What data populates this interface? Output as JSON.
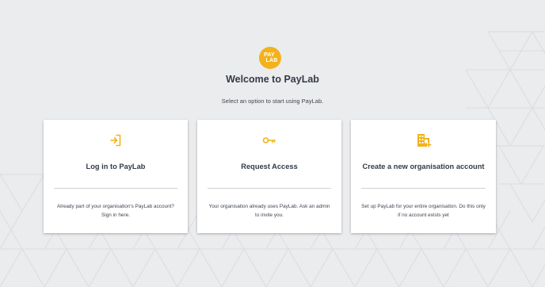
{
  "logo": {
    "line1": "PAY",
    "line2": "LAB"
  },
  "title": "Welcome to PayLab",
  "subtitle": "Select an option to start using PayLab.",
  "accent_color": "#f3b21b",
  "cards": [
    {
      "icon": "login-arrow-icon",
      "title": "Log in to PayLab",
      "description": "Already part of your organisation's PayLab account? Sign in here."
    },
    {
      "icon": "key-icon",
      "title": "Request Access",
      "description": "Your organisation already uses PayLab. Ask an admin to invite you."
    },
    {
      "icon": "building-add-icon",
      "title": "Create a new organisation account",
      "description": "Set up PayLab for your entire organisation. Do this only if no account exists yet"
    }
  ]
}
